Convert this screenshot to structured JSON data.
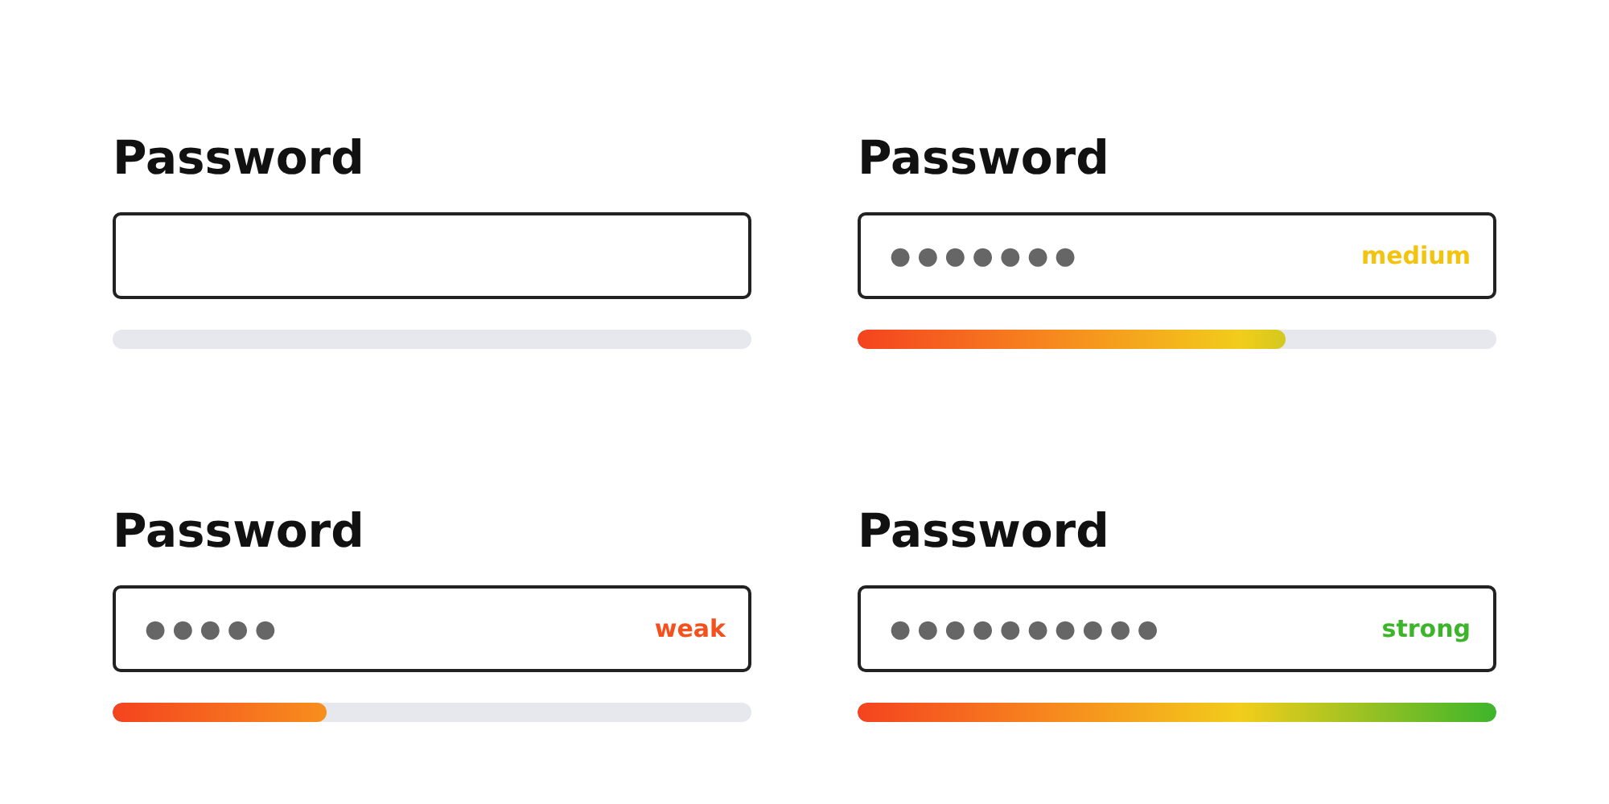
{
  "fields": [
    {
      "label": "Password"
    },
    {
      "label": "Password",
      "value": "●●●●●●●",
      "strength": {
        "text": "medium",
        "color": "#f2c40f"
      },
      "level": 0.67
    },
    {
      "label": "Password",
      "value": "●●●●●",
      "strength": {
        "text": "weak",
        "color": "#f4511e"
      },
      "level": 0.335
    },
    {
      "label": "Password",
      "value": "●●●●●●●●●●",
      "strength": {
        "text": "strong",
        "color": "#3db52b"
      },
      "level": 1
    }
  ]
}
